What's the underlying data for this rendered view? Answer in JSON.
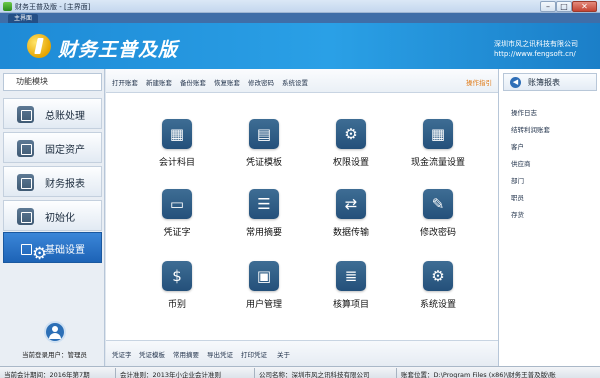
{
  "window": {
    "title": "财务王普及版 - [主界面]",
    "controls": {
      "minimize": "–",
      "maximize": "□",
      "close": "✕"
    }
  },
  "tabs": {
    "home": "主界面"
  },
  "banner": {
    "app_name": "财务王普及版",
    "company": "深圳市风之讯科技有限公司",
    "website": "http://www.fengsoft.cn/"
  },
  "sidebar": {
    "heading": "功能模块",
    "items": [
      {
        "label": "总账处理",
        "icon": "ledger-icon"
      },
      {
        "label": "固定资产",
        "icon": "asset-icon"
      },
      {
        "label": "财务报表",
        "icon": "report-icon"
      },
      {
        "label": "初始化",
        "icon": "init-icon"
      },
      {
        "label": "基础设置",
        "icon": "gear-icon",
        "active": true
      }
    ],
    "user_line": "当前登录用户：管理员"
  },
  "toolbar": {
    "items": [
      "打开账套",
      "新建账套",
      "备份账套",
      "恢复账套",
      "修改密码",
      "系统设置"
    ],
    "guide": "操作指引"
  },
  "tiles": [
    {
      "label": "会计科目",
      "glyph": "▦"
    },
    {
      "label": "凭证模板",
      "glyph": "▤"
    },
    {
      "label": "权限设置",
      "glyph": "⚙"
    },
    {
      "label": "现金流量设置",
      "glyph": "▦"
    },
    {
      "label": "凭证字",
      "glyph": "▭"
    },
    {
      "label": "常用摘要",
      "glyph": "☰"
    },
    {
      "label": "数据传输",
      "glyph": "⇄"
    },
    {
      "label": "修改密码",
      "glyph": "✎"
    },
    {
      "label": "币别",
      "glyph": "$"
    },
    {
      "label": "用户管理",
      "glyph": "▣"
    },
    {
      "label": "核算项目",
      "glyph": "≣"
    },
    {
      "label": "系统设置",
      "glyph": "⚙"
    }
  ],
  "bottom_links": [
    "凭证字",
    "凭证模板",
    "常用摘要",
    "导出凭证",
    "打印凭证",
    "关于"
  ],
  "right_panel": {
    "title": "账簿报表",
    "links": [
      "操作日志",
      "结转利润账套",
      "客户",
      "供应商",
      "部门",
      "职员",
      "存货"
    ]
  },
  "status": {
    "period": "当前会计期间：2016年第7期",
    "standard": "会计准则：2013年小企业会计准则",
    "company": "公司名称：深圳市风之讯科技有限公司",
    "location": "账套位置：D:\\Program Files (x86)\\财务王普及版\\账"
  },
  "colors": {
    "banner": "#2aa0e6",
    "sidebar_active": "#1d63b6",
    "tile_icon": "#2f5c85",
    "guide_link": "#e07b18"
  }
}
